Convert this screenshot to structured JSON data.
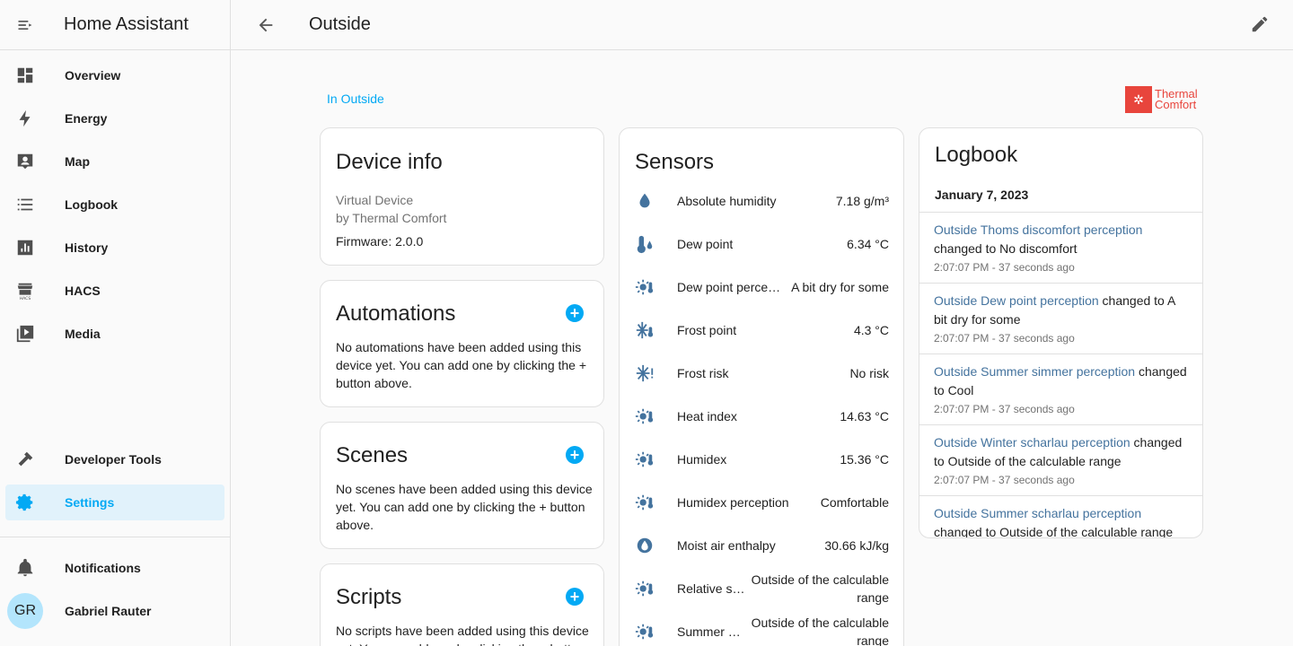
{
  "app": {
    "title": "Home Assistant"
  },
  "sidebar": {
    "items": [
      {
        "label": "Overview",
        "icon": "dashboard-icon"
      },
      {
        "label": "Energy",
        "icon": "lightning-icon"
      },
      {
        "label": "Map",
        "icon": "map-person-icon"
      },
      {
        "label": "Logbook",
        "icon": "list-icon"
      },
      {
        "label": "History",
        "icon": "chart-box-icon"
      },
      {
        "label": "HACS",
        "icon": "hacs-icon"
      },
      {
        "label": "Media",
        "icon": "media-icon"
      }
    ],
    "developer_tools": "Developer Tools",
    "settings": "Settings",
    "notifications": "Notifications",
    "user": {
      "initials": "GR",
      "name": "Gabriel Rauter"
    }
  },
  "header": {
    "title": "Outside"
  },
  "area_link": "In Outside",
  "brand": {
    "line1": "Thermal",
    "line2": "Comfort"
  },
  "device_info": {
    "title": "Device info",
    "model": "Virtual Device",
    "manufacturer": "by Thermal Comfort",
    "firmware": "Firmware: 2.0.0"
  },
  "automations": {
    "title": "Automations",
    "text": "No automations have been added using this device yet. You can add one by clicking the + button above."
  },
  "scenes": {
    "title": "Scenes",
    "text": "No scenes have been added using this device yet. You can add one by clicking the + button above."
  },
  "scripts": {
    "title": "Scripts",
    "text": "No scripts have been added using this device yet. You can add one by clicking the + button above."
  },
  "sensors": {
    "title": "Sensors",
    "rows": [
      {
        "name": "Absolute humidity",
        "value": "7.18 g/m³",
        "icon": "water-drop-icon"
      },
      {
        "name": "Dew point",
        "value": "6.34 °C",
        "icon": "thermometer-water-icon"
      },
      {
        "name": "Dew point perce…",
        "value": "A bit dry for some",
        "icon": "sun-thermometer-icon"
      },
      {
        "name": "Frost point",
        "value": "4.3 °C",
        "icon": "snowflake-thermometer-icon"
      },
      {
        "name": "Frost risk",
        "value": "No risk",
        "icon": "snowflake-alert-icon"
      },
      {
        "name": "Heat index",
        "value": "14.63 °C",
        "icon": "sun-thermometer-icon"
      },
      {
        "name": "Humidex",
        "value": "15.36 °C",
        "icon": "sun-thermometer-icon"
      },
      {
        "name": "Humidex perception",
        "value": "Comfortable",
        "icon": "sun-thermometer-icon"
      },
      {
        "name": "Moist air enthalpy",
        "value": "30.66 kJ/kg",
        "icon": "water-circle-icon"
      },
      {
        "name": "Relative s…",
        "value": "Outside of the calculable range",
        "icon": "sun-thermometer-icon"
      },
      {
        "name": "Summer …",
        "value": "Outside of the calculable range",
        "icon": "sun-thermometer-icon"
      }
    ]
  },
  "logbook": {
    "title": "Logbook",
    "date": "January 7, 2023",
    "entries": [
      {
        "entity": "Outside Thoms discomfort perception",
        "change": " changed to No discomfort",
        "time": "2:07:07 PM - 37 seconds ago"
      },
      {
        "entity": "Outside Dew point perception",
        "change": " changed to A bit dry for some",
        "time": "2:07:07 PM - 37 seconds ago"
      },
      {
        "entity": "Outside Summer simmer perception",
        "change": " changed to Cool",
        "time": "2:07:07 PM - 37 seconds ago"
      },
      {
        "entity": "Outside Winter scharlau perception",
        "change": " changed to Outside of the calculable range",
        "time": "2:07:07 PM - 37 seconds ago"
      },
      {
        "entity": "Outside Summer scharlau perception",
        "change": " changed to Outside of the calculable range",
        "time": ""
      }
    ]
  },
  "colors": {
    "accent": "#03a9f4",
    "entity_link": "#44739e",
    "brand": "#e8453c",
    "active_bg": "#e1f2fb"
  }
}
